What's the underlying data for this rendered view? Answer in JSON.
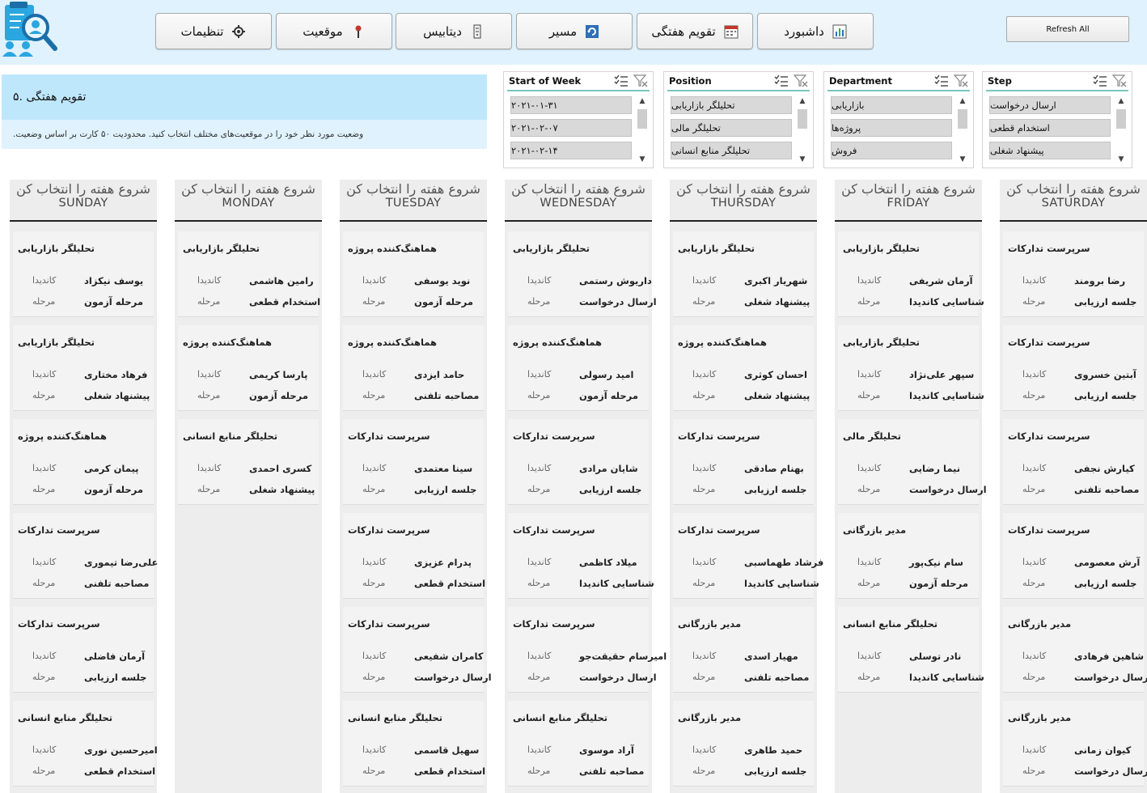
{
  "nav": {
    "buttons": [
      {
        "label": "تنظیمات",
        "icon": "gear-icon"
      },
      {
        "label": "موقعیت",
        "icon": "pin-icon"
      },
      {
        "label": "دیتابیس",
        "icon": "database-icon"
      },
      {
        "label": "مسیر",
        "icon": "refresh-path-icon"
      },
      {
        "label": "تقویم هفتگی",
        "icon": "calendar-icon"
      },
      {
        "label": "داشبورد",
        "icon": "bar-chart-icon"
      }
    ],
    "refresh_label": "Refresh All"
  },
  "info": {
    "title": "تقویم هفتگی .۵",
    "description": "وضعیت مورد نظر خود را در موقعیت‌های مختلف انتخاب کنید. محدودیت ۵۰ کارت بر اساس وضعیت."
  },
  "slicers": [
    {
      "title": "Start of Week",
      "items": [
        "۲۰۲۱-۰۱-۳۱",
        "۲۰۲۱-۰۲-۰۷",
        "۲۰۲۱-۰۲-۱۴"
      ]
    },
    {
      "title": "Position",
      "items": [
        "تحلیلگر بازاریابی",
        "تحلیلگر مالی",
        "تحلیلگر منابع انسانی"
      ]
    },
    {
      "title": "Department",
      "items": [
        "بازاریابی",
        "پروژه‌ها",
        "فروش"
      ]
    },
    {
      "title": "Step",
      "items": [
        "ارسال درخواست",
        "استخدام قطعی",
        "پیشنهاد شغلی"
      ]
    }
  ],
  "card_labels": {
    "candidate": "کاندیدا",
    "step": "مرحله"
  },
  "columns": [
    {
      "title": "شروع هفته را انتخاب کن",
      "day": "SUNDAY",
      "cards": [
        {
          "position": "تحلیلگر بازاریابی",
          "candidate": "یوسف نیکزاد",
          "step": "مرحله آزمون"
        },
        {
          "position": "تحلیلگر بازاریابی",
          "candidate": "فرهاد مختاری",
          "step": "پیشنهاد شغلی"
        },
        {
          "position": "هماهنگ‌کننده پروژه",
          "candidate": "پیمان کرمی",
          "step": "مرحله آزمون"
        },
        {
          "position": "سرپرست تدارکات",
          "candidate": "علی‌رضا تیموری",
          "step": "مصاحبه تلفنی"
        },
        {
          "position": "سرپرست تدارکات",
          "candidate": "آرمان فاضلی",
          "step": "جلسه ارزیابی"
        },
        {
          "position": "تحلیلگر منابع انسانی",
          "candidate": "امیرحسین نوری",
          "step": "استخدام قطعی"
        }
      ]
    },
    {
      "title": "شروع هفته را انتخاب کن",
      "day": "MONDAY",
      "cards": [
        {
          "position": "تحلیلگر بازاریابی",
          "candidate": "رامین هاشمی",
          "step": "استخدام قطعی"
        },
        {
          "position": "هماهنگ‌کننده پروژه",
          "candidate": "پارسا کریمی",
          "step": "مرحله آزمون"
        },
        {
          "position": "تحلیلگر منابع انسانی",
          "candidate": "کسری احمدی",
          "step": "پیشنهاد شغلی"
        }
      ]
    },
    {
      "title": "شروع هفته را انتخاب کن",
      "day": "TUESDAY",
      "cards": [
        {
          "position": "هماهنگ‌کننده پروژه",
          "candidate": "نوید یوسفی",
          "step": "مرحله آزمون"
        },
        {
          "position": "هماهنگ‌کننده پروژه",
          "candidate": "حامد ایزدی",
          "step": "مصاحبه تلفنی"
        },
        {
          "position": "سرپرست تدارکات",
          "candidate": "سینا معتمدی",
          "step": "جلسه ارزیابی"
        },
        {
          "position": "سرپرست تدارکات",
          "candidate": "پدرام عزیزی",
          "step": "استخدام قطعی"
        },
        {
          "position": "سرپرست تدارکات",
          "candidate": "کامران شفیعی",
          "step": "ارسال درخواست"
        },
        {
          "position": "تحلیلگر منابع انسانی",
          "candidate": "سهیل قاسمی",
          "step": "استخدام قطعی"
        }
      ]
    },
    {
      "title": "شروع هفته را انتخاب کن",
      "day": "WEDNESDAY",
      "cards": [
        {
          "position": "تحلیلگر بازاریابی",
          "candidate": "داریوش رستمی",
          "step": "ارسال درخواست"
        },
        {
          "position": "هماهنگ‌کننده پروژه",
          "candidate": "امید رسولی",
          "step": "مرحله آزمون"
        },
        {
          "position": "سرپرست تدارکات",
          "candidate": "شایان مرادی",
          "step": "جلسه ارزیابی"
        },
        {
          "position": "سرپرست تدارکات",
          "candidate": "میلاد کاظمی",
          "step": "شناسایی کاندیدا"
        },
        {
          "position": "سرپرست تدارکات",
          "candidate": "امیرسام حقیقت‌جو",
          "step": "ارسال درخواست"
        },
        {
          "position": "تحلیلگر منابع انسانی",
          "candidate": "آراد موسوی",
          "step": "مصاحبه تلفنی"
        }
      ]
    },
    {
      "title": "شروع هفته را انتخاب کن",
      "day": "THURSDAY",
      "cards": [
        {
          "position": "تحلیلگر بازاریابی",
          "candidate": "شهریار اکبری",
          "step": "پیشنهاد شغلی"
        },
        {
          "position": "هماهنگ‌کننده پروژه",
          "candidate": "احسان کوثری",
          "step": "پیشنهاد شغلی"
        },
        {
          "position": "سرپرست تدارکات",
          "candidate": "بهنام صادقی",
          "step": "جلسه ارزیابی"
        },
        {
          "position": "سرپرست تدارکات",
          "candidate": "فرشاد طهماسبی",
          "step": "شناسایی کاندیدا"
        },
        {
          "position": "مدیر بازرگانی",
          "candidate": "مهیار اسدی",
          "step": "مصاحبه تلفنی"
        },
        {
          "position": "مدیر بازرگانی",
          "candidate": "حمید طاهری",
          "step": "جلسه ارزیابی"
        }
      ]
    },
    {
      "title": "شروع هفته را انتخاب کن",
      "day": "FRIDAY",
      "cards": [
        {
          "position": "تحلیلگر بازاریابی",
          "candidate": "آرمان شریفی",
          "step": "شناسایی کاندیدا"
        },
        {
          "position": "تحلیلگر بازاریابی",
          "candidate": "سپهر علی‌نژاد",
          "step": "شناسایی کاندیدا"
        },
        {
          "position": "تحلیلگر مالی",
          "candidate": "نیما رضایی",
          "step": "ارسال درخواست"
        },
        {
          "position": "مدیر بازرگانی",
          "candidate": "سام نیک‌پور",
          "step": "مرحله آزمون"
        },
        {
          "position": "تحلیلگر منابع انسانی",
          "candidate": "نادر توسلی",
          "step": "شناسایی کاندیدا"
        }
      ]
    },
    {
      "title": "شروع هفته را انتخاب کن",
      "day": "SATURDAY",
      "cards": [
        {
          "position": "سرپرست تدارکات",
          "candidate": "رضا برومند",
          "step": "جلسه ارزیابی"
        },
        {
          "position": "سرپرست تدارکات",
          "candidate": "آبتین خسروی",
          "step": "جلسه ارزیابی"
        },
        {
          "position": "سرپرست تدارکات",
          "candidate": "کیارش نجفی",
          "step": "مصاحبه تلفنی"
        },
        {
          "position": "سرپرست تدارکات",
          "candidate": "آرش معصومی",
          "step": "جلسه ارزیابی"
        },
        {
          "position": "مدیر بازرگانی",
          "candidate": "شاهین فرهادی",
          "step": "ارسال درخواست"
        },
        {
          "position": "مدیر بازرگانی",
          "candidate": "کیوان زمانی",
          "step": "ارسال درخواست"
        }
      ]
    }
  ]
}
